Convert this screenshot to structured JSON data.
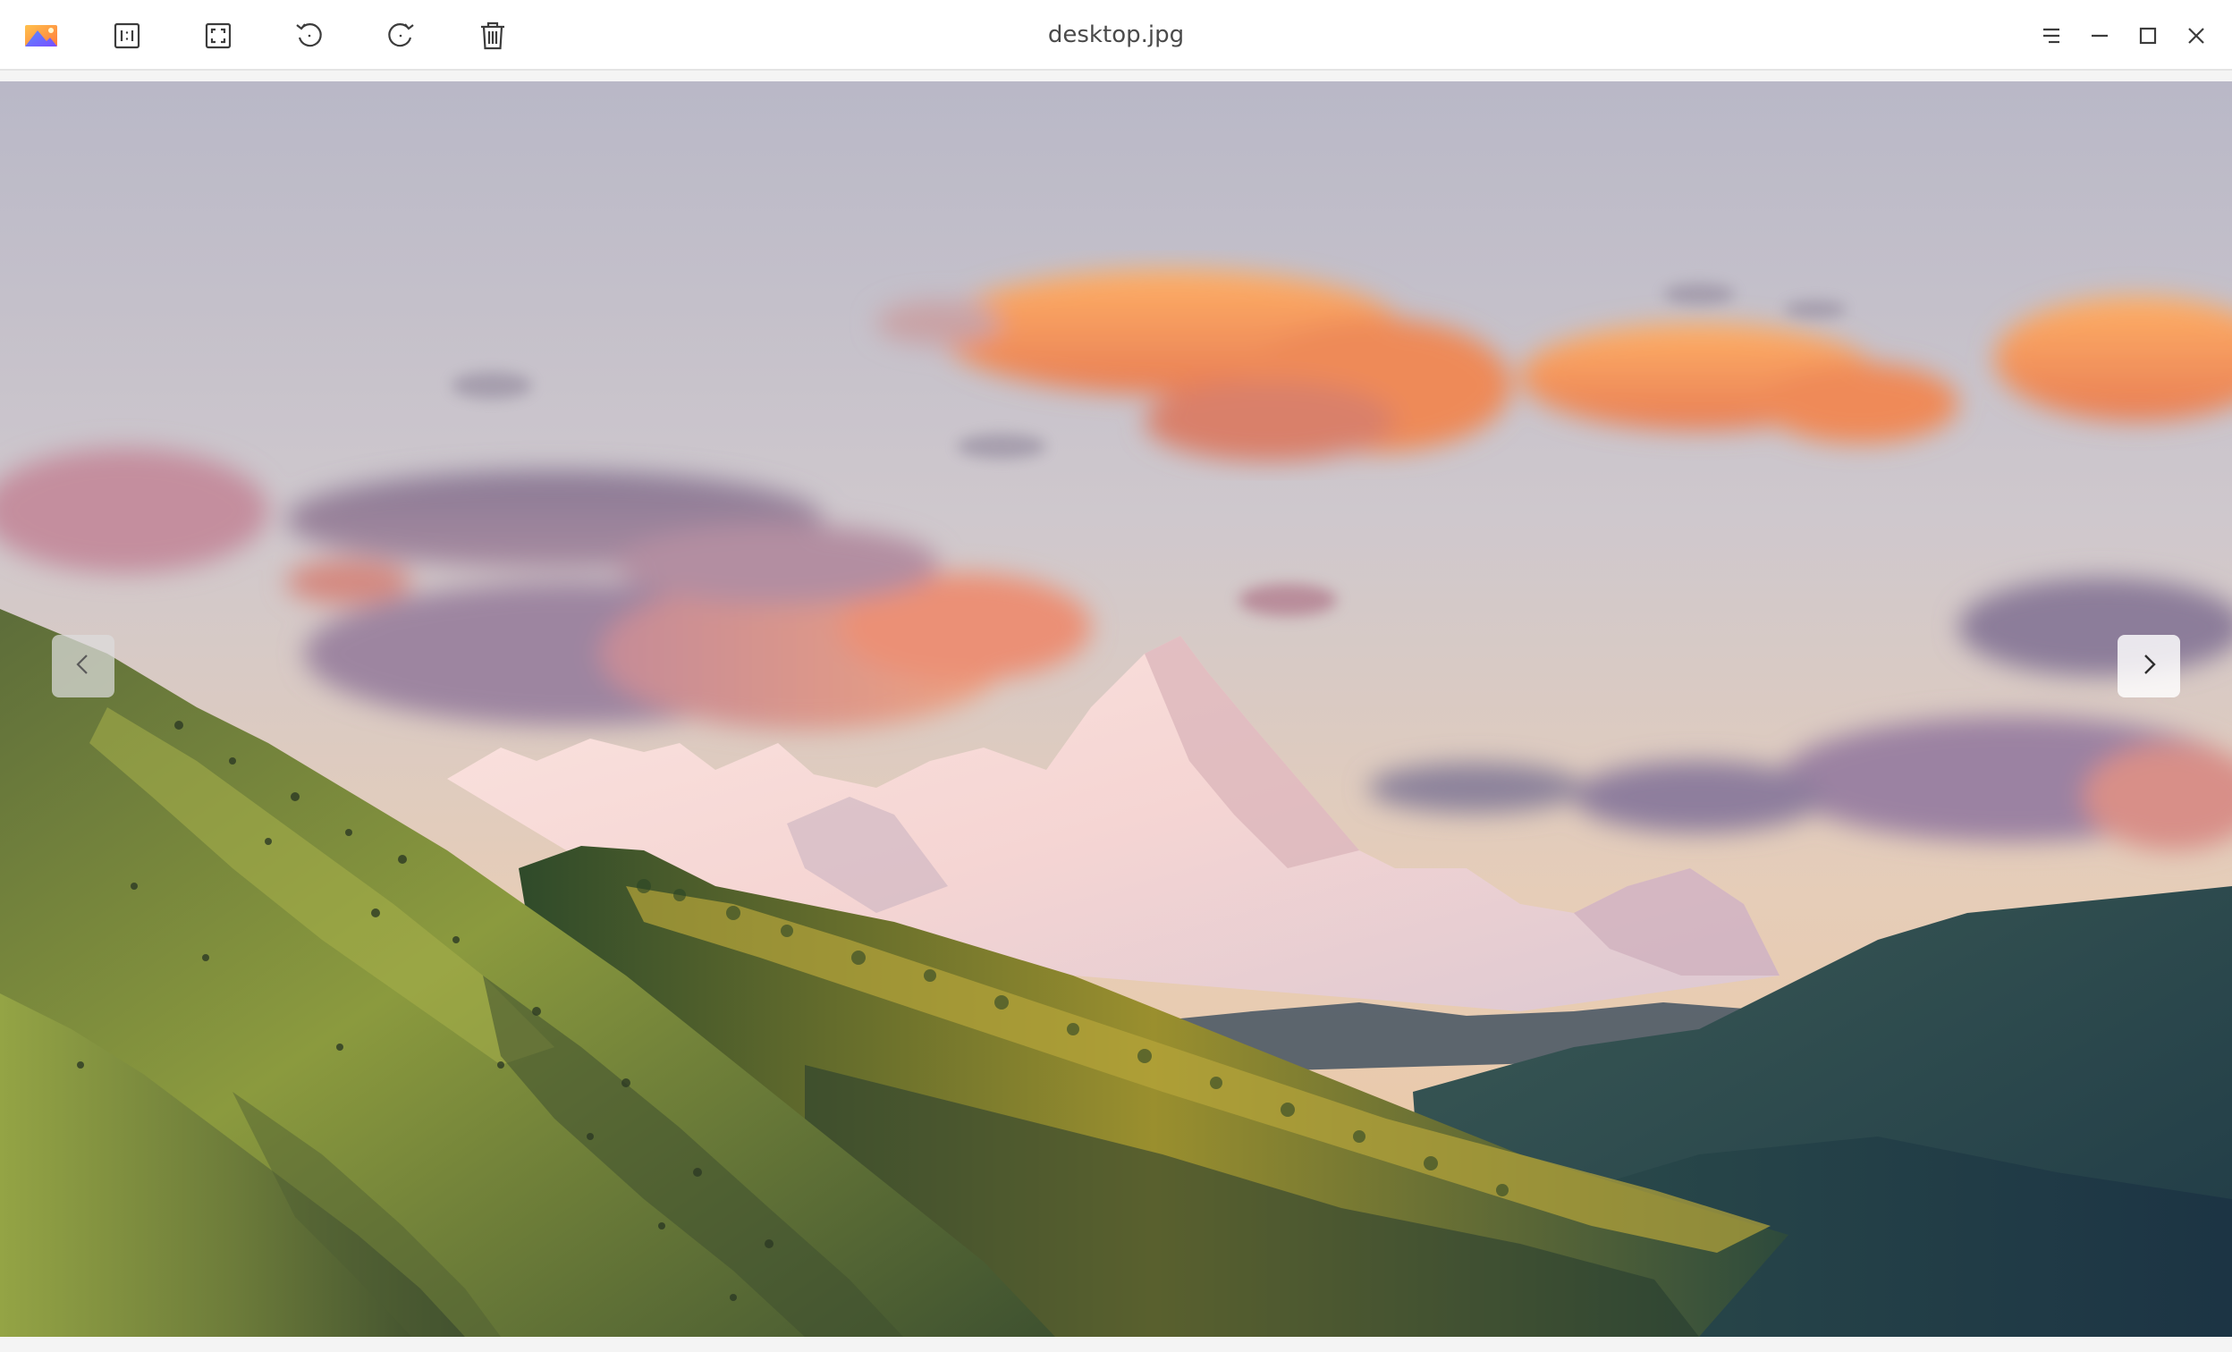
{
  "window": {
    "title": "desktop.jpg"
  },
  "toolbar": {
    "items": [
      {
        "name": "app-logo-icon",
        "icon": "image-viewer-logo"
      },
      {
        "name": "actual-size-icon",
        "icon": "ratio-1-1"
      },
      {
        "name": "fit-window-icon",
        "icon": "fit-to-window"
      },
      {
        "name": "rotate-left-icon",
        "icon": "rotate-counterclockwise"
      },
      {
        "name": "rotate-right-icon",
        "icon": "rotate-clockwise"
      },
      {
        "name": "delete-icon",
        "icon": "trash"
      }
    ]
  },
  "window_controls": {
    "items": [
      {
        "name": "menu-icon",
        "icon": "hamburger-menu"
      },
      {
        "name": "minimize-icon",
        "icon": "minimize"
      },
      {
        "name": "maximize-icon",
        "icon": "maximize"
      },
      {
        "name": "close-icon",
        "icon": "close"
      }
    ]
  },
  "viewer": {
    "image_subject": "mountain-landscape",
    "prev_icon": "chevron-left",
    "next_icon": "chevron-right"
  },
  "colors": {
    "titlebar_bg": "#ffffff",
    "title_text": "#4a4a4a",
    "icon_color": "#3c3c3c",
    "viewer_bg": "#f4f4f4"
  }
}
